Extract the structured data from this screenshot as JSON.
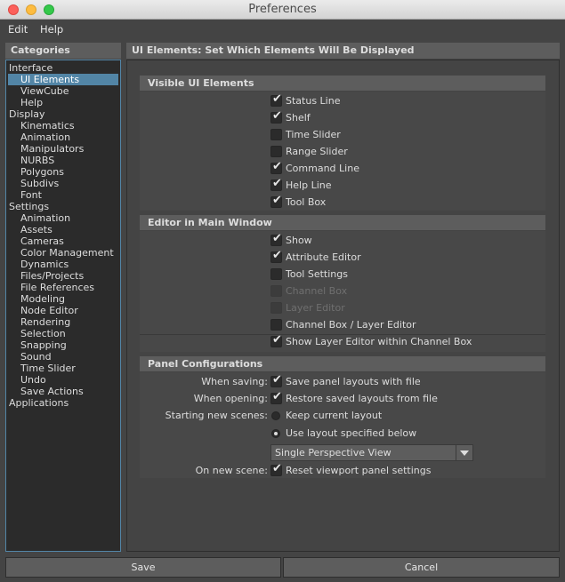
{
  "window": {
    "title": "Preferences"
  },
  "menu": [
    "Edit",
    "Help"
  ],
  "categories": {
    "header": "Categories",
    "items": [
      {
        "label": "Interface",
        "level": 0
      },
      {
        "label": "UI Elements",
        "level": 1,
        "selected": true
      },
      {
        "label": "ViewCube",
        "level": 1
      },
      {
        "label": "Help",
        "level": 1
      },
      {
        "label": "Display",
        "level": 0
      },
      {
        "label": "Kinematics",
        "level": 1
      },
      {
        "label": "Animation",
        "level": 1
      },
      {
        "label": "Manipulators",
        "level": 1
      },
      {
        "label": "NURBS",
        "level": 1
      },
      {
        "label": "Polygons",
        "level": 1
      },
      {
        "label": "Subdivs",
        "level": 1
      },
      {
        "label": "Font",
        "level": 1
      },
      {
        "label": "Settings",
        "level": 0
      },
      {
        "label": "Animation",
        "level": 1
      },
      {
        "label": "Assets",
        "level": 1
      },
      {
        "label": "Cameras",
        "level": 1
      },
      {
        "label": "Color Management",
        "level": 1
      },
      {
        "label": "Dynamics",
        "level": 1
      },
      {
        "label": "Files/Projects",
        "level": 1
      },
      {
        "label": "File References",
        "level": 1
      },
      {
        "label": "Modeling",
        "level": 1
      },
      {
        "label": "Node Editor",
        "level": 1
      },
      {
        "label": "Rendering",
        "level": 1
      },
      {
        "label": "Selection",
        "level": 1
      },
      {
        "label": "Snapping",
        "level": 1
      },
      {
        "label": "Sound",
        "level": 1
      },
      {
        "label": "Time Slider",
        "level": 1
      },
      {
        "label": "Undo",
        "level": 1
      },
      {
        "label": "Save Actions",
        "level": 1
      },
      {
        "label": "Applications",
        "level": 0
      }
    ]
  },
  "main": {
    "header": "UI Elements: Set Which Elements Will Be Displayed",
    "visible_ui": {
      "title": "Visible UI Elements",
      "options": [
        {
          "label": "Status Line",
          "checked": true
        },
        {
          "label": "Shelf",
          "checked": true
        },
        {
          "label": "Time Slider",
          "checked": false
        },
        {
          "label": "Range Slider",
          "checked": false
        },
        {
          "label": "Command Line",
          "checked": true
        },
        {
          "label": "Help Line",
          "checked": true
        },
        {
          "label": "Tool Box",
          "checked": true
        }
      ]
    },
    "editor": {
      "title": "Editor in Main Window",
      "options": [
        {
          "label": "Show",
          "checked": true,
          "disabled": false
        },
        {
          "label": "Attribute Editor",
          "checked": true,
          "disabled": false
        },
        {
          "label": "Tool Settings",
          "checked": false,
          "disabled": false
        },
        {
          "label": "Channel Box",
          "checked": false,
          "disabled": true
        },
        {
          "label": "Layer Editor",
          "checked": false,
          "disabled": true
        },
        {
          "label": "Channel Box / Layer Editor",
          "checked": false,
          "disabled": false
        },
        {
          "label": "Show Layer Editor within Channel Box",
          "checked": true,
          "disabled": false
        }
      ]
    },
    "panel": {
      "title": "Panel Configurations",
      "when_saving_label": "When saving:",
      "when_saving_option": "Save panel layouts with file",
      "when_opening_label": "When opening:",
      "when_opening_option": "Restore saved layouts from file",
      "starting_label": "Starting new scenes:",
      "radio_keep": "Keep current layout",
      "radio_use": "Use layout specified below",
      "layout_value": "Single Perspective View",
      "on_new_label": "On new scene:",
      "on_new_option": "Reset viewport panel settings"
    }
  },
  "buttons": {
    "save": "Save",
    "cancel": "Cancel"
  },
  "icons": {
    "check": "✔",
    "close": "close-icon",
    "minimize": "minimize-icon",
    "maximize": "maximize-icon",
    "dropdown": "chevron-down-icon"
  }
}
